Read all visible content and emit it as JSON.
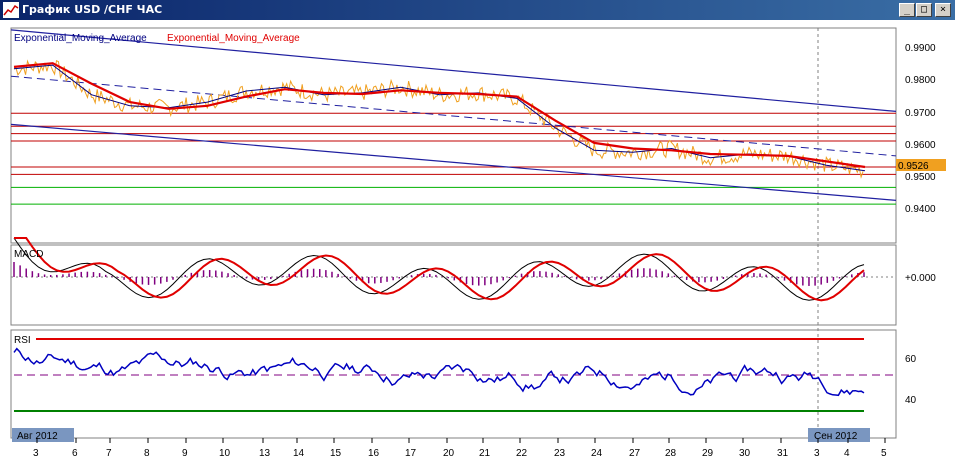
{
  "window": {
    "title": "График USD /CHF ЧАС",
    "buttons": {
      "minimize": "_",
      "maximize": "□",
      "close": "×"
    }
  },
  "colors": {
    "price": "#f0a020",
    "ema_fast": "#000080",
    "ema_slow": "#e00000",
    "channel": "#2020a0",
    "hline": "#c00000",
    "support": "#00b000",
    "macd_hist": "#800080",
    "rsi": "#0000c0",
    "rsi_upper": "#e00000",
    "rsi_lower": "#008000",
    "current_price_bg": "#f0a020",
    "date_label_bg": "#7a96c0"
  },
  "main_panel": {
    "legend": [
      "Exponential_Moving_Average",
      "Exponential_Moving_Average"
    ],
    "current_price": "0.9526"
  },
  "macd_panel": {
    "label": "MACD"
  },
  "rsi_panel": {
    "label": "RSI"
  },
  "date_labels": {
    "start": "Авг 2012",
    "end": "Сен 2012"
  },
  "chart_data": {
    "type": "line",
    "title": "",
    "x_ticks": [
      "3",
      "6",
      "7",
      "8",
      "9",
      "10",
      "13",
      "14",
      "15",
      "16",
      "17",
      "20",
      "21",
      "22",
      "23",
      "24",
      "27",
      "28",
      "29",
      "30",
      "31",
      "3",
      "4",
      "5"
    ],
    "price_axis": {
      "ticks": [
        "0.9900",
        "0.9800",
        "0.9700",
        "0.9600",
        "0.9500",
        "0.9400"
      ],
      "ylim": [
        0.935,
        0.993
      ]
    },
    "macd_axis": {
      "ticks": [
        "+0.000"
      ]
    },
    "rsi_axis": {
      "ticks": [
        "60",
        "40"
      ],
      "upper_level": 70,
      "lower_level": 30
    },
    "series": [
      {
        "name": "Exponential_Moving_Average",
        "values": [
          0.982,
          0.983,
          0.975,
          0.972,
          0.9715,
          0.973,
          0.976,
          0.977,
          0.975,
          0.9755,
          0.977,
          0.975,
          0.9755,
          0.974,
          0.966,
          0.96,
          0.9595,
          0.9605,
          0.958,
          0.959,
          0.9585,
          0.956,
          0.9545
        ]
      },
      {
        "name": "Exponential_Moving_Average",
        "values": [
          0.9825,
          0.9835,
          0.978,
          0.973,
          0.9712,
          0.972,
          0.9745,
          0.9765,
          0.9755,
          0.9752,
          0.9762,
          0.9755,
          0.9752,
          0.9745,
          0.968,
          0.962,
          0.9605,
          0.96,
          0.959,
          0.9588,
          0.9585,
          0.957,
          0.9555
        ]
      }
    ],
    "horizontal_lines": [
      0.97,
      0.9665,
      0.9645,
      0.9625,
      0.9555,
      0.9535,
      0.95,
      0.9455
    ]
  }
}
